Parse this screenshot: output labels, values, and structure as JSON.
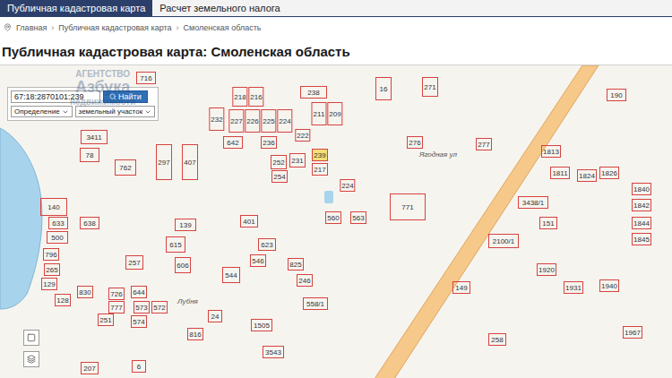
{
  "tabs": [
    {
      "label": "Публичная кадастровая карта",
      "selected": true
    },
    {
      "label": "Расчет земельного налога",
      "selected": false
    }
  ],
  "breadcrumbs": [
    "Главная",
    "Публичная кадастровая карта",
    "Смоленская область"
  ],
  "breadcrumb_separator": "›",
  "title": "Публичная кадастровая карта: Смоленская область",
  "search": {
    "value": "67:18:2870101:239",
    "button": "Найти",
    "mode": "Определение",
    "object_type": "земельный участок"
  },
  "watermark": {
    "lines": [
      "АГЕНТСТВО",
      "Азбука",
      "недвижимости"
    ]
  },
  "streets": [
    "Ягодная ул",
    "Лубня"
  ],
  "parcels": [
    {
      "label": "716",
      "selected": false
    },
    {
      "label": "218",
      "selected": false
    },
    {
      "label": "216",
      "selected": false
    },
    {
      "label": "238",
      "selected": false
    },
    {
      "label": "16",
      "selected": false
    },
    {
      "label": "642",
      "selected": false
    },
    {
      "label": "232",
      "selected": false
    },
    {
      "label": "227",
      "selected": false
    },
    {
      "label": "226",
      "selected": false
    },
    {
      "label": "225",
      "selected": false
    },
    {
      "label": "224",
      "selected": false
    },
    {
      "label": "211",
      "selected": false
    },
    {
      "label": "209",
      "selected": false
    },
    {
      "label": "236",
      "selected": false
    },
    {
      "label": "222",
      "selected": false
    },
    {
      "label": "3411",
      "selected": false
    },
    {
      "label": "78",
      "selected": false
    },
    {
      "label": "762",
      "selected": false
    },
    {
      "label": "297",
      "selected": false
    },
    {
      "label": "407",
      "selected": false
    },
    {
      "label": "252",
      "selected": false
    },
    {
      "label": "254",
      "selected": false
    },
    {
      "label": "231",
      "selected": false
    },
    {
      "label": "239",
      "selected": true
    },
    {
      "label": "217",
      "selected": false
    },
    {
      "label": "224",
      "selected": false
    },
    {
      "label": "771",
      "selected": false
    },
    {
      "label": "140",
      "selected": false
    },
    {
      "label": "633",
      "selected": false
    },
    {
      "label": "638",
      "selected": false
    },
    {
      "label": "500",
      "selected": false
    },
    {
      "label": "139",
      "selected": false
    },
    {
      "label": "401",
      "selected": false
    },
    {
      "label": "615",
      "selected": false
    },
    {
      "label": "623",
      "selected": false
    },
    {
      "label": "560",
      "selected": false
    },
    {
      "label": "563",
      "selected": false
    },
    {
      "label": "271",
      "selected": false
    },
    {
      "label": "276",
      "selected": false
    },
    {
      "label": "277",
      "selected": false
    },
    {
      "label": "190",
      "selected": false
    },
    {
      "label": "1813",
      "selected": false
    },
    {
      "label": "1811",
      "selected": false
    },
    {
      "label": "1824",
      "selected": false
    },
    {
      "label": "1826",
      "selected": false
    },
    {
      "label": "1840",
      "selected": false
    },
    {
      "label": "1842",
      "selected": false
    },
    {
      "label": "1844",
      "selected": false
    },
    {
      "label": "1845",
      "selected": false
    },
    {
      "label": "3438/1",
      "selected": false
    },
    {
      "label": "2100/1",
      "selected": false
    },
    {
      "label": "151",
      "selected": false
    },
    {
      "label": "1920",
      "selected": false
    },
    {
      "label": "1931",
      "selected": false
    },
    {
      "label": "1940",
      "selected": false
    },
    {
      "label": "1967",
      "selected": false
    },
    {
      "label": "149",
      "selected": false
    },
    {
      "label": "258",
      "selected": false
    },
    {
      "label": "796",
      "selected": false
    },
    {
      "label": "265",
      "selected": false
    },
    {
      "label": "129",
      "selected": false
    },
    {
      "label": "128",
      "selected": false
    },
    {
      "label": "830",
      "selected": false
    },
    {
      "label": "726",
      "selected": false
    },
    {
      "label": "644",
      "selected": false
    },
    {
      "label": "777",
      "selected": false
    },
    {
      "label": "251",
      "selected": false
    },
    {
      "label": "573",
      "selected": false
    },
    {
      "label": "572",
      "selected": false
    },
    {
      "label": "574",
      "selected": false
    },
    {
      "label": "257",
      "selected": false
    },
    {
      "label": "606",
      "selected": false
    },
    {
      "label": "544",
      "selected": false
    },
    {
      "label": "24",
      "selected": false
    },
    {
      "label": "816",
      "selected": false
    },
    {
      "label": "207",
      "selected": false
    },
    {
      "label": "6",
      "selected": false
    },
    {
      "label": "546",
      "selected": false
    },
    {
      "label": "825",
      "selected": false
    },
    {
      "label": "246",
      "selected": false
    },
    {
      "label": "558/1",
      "selected": false
    },
    {
      "label": "1505",
      "selected": false
    },
    {
      "label": "3543",
      "selected": false
    }
  ]
}
